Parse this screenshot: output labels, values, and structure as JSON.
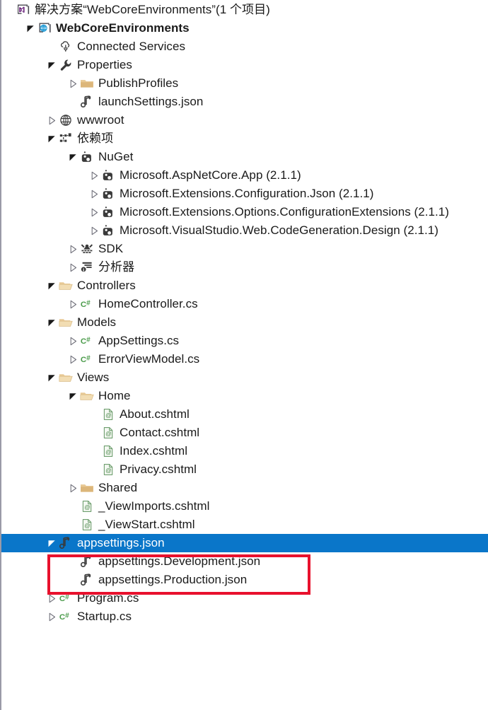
{
  "window": {
    "title": "解决方案“WebCoreEnvironments”(1 个项目)",
    "background_color": "#ffffff",
    "selection_color": "#0a76c9",
    "annotation_color": "#e8112d",
    "text_color": "#1a1a1a"
  },
  "annotation": {
    "name": "red-highlight-box",
    "target_rows": [
      "appsettings.Development.json",
      "appsettings.Production.json"
    ]
  },
  "tree": {
    "nodes": [
      {
        "label": "解决方案“WebCoreEnvironments”(1 个项目)",
        "icon": "visual-studio-solution-icon",
        "depth": 0,
        "expander": "none",
        "bold": false,
        "selected": false
      },
      {
        "label": "WebCoreEnvironments",
        "icon": "web-project-icon",
        "depth": 1,
        "expander": "expanded",
        "bold": true,
        "selected": false
      },
      {
        "label": "Connected Services",
        "icon": "connected-services-icon",
        "depth": 2,
        "expander": "none",
        "bold": false,
        "selected": false
      },
      {
        "label": "Properties",
        "icon": "wrench-icon",
        "depth": 2,
        "expander": "expanded",
        "bold": false,
        "selected": false
      },
      {
        "label": "PublishProfiles",
        "icon": "folder-closed-icon",
        "depth": 3,
        "expander": "collapsed",
        "bold": false,
        "selected": false
      },
      {
        "label": "launchSettings.json",
        "icon": "json-file-icon",
        "depth": 3,
        "expander": "none",
        "bold": false,
        "selected": false
      },
      {
        "label": "wwwroot",
        "icon": "globe-icon",
        "depth": 2,
        "expander": "collapsed",
        "bold": false,
        "selected": false
      },
      {
        "label": "依赖项",
        "icon": "dependencies-icon",
        "depth": 2,
        "expander": "expanded",
        "bold": false,
        "selected": false
      },
      {
        "label": "NuGet",
        "icon": "nuget-package-icon",
        "depth": 3,
        "expander": "expanded",
        "bold": false,
        "selected": false
      },
      {
        "label": "Microsoft.AspNetCore.App (2.1.1)",
        "icon": "nuget-package-icon",
        "depth": 4,
        "expander": "collapsed",
        "bold": false,
        "selected": false
      },
      {
        "label": "Microsoft.Extensions.Configuration.Json (2.1.1)",
        "icon": "nuget-package-icon",
        "depth": 4,
        "expander": "collapsed",
        "bold": false,
        "selected": false
      },
      {
        "label": "Microsoft.Extensions.Options.ConfigurationExtensions (2.1.1)",
        "icon": "nuget-package-icon",
        "depth": 4,
        "expander": "collapsed",
        "bold": false,
        "selected": false
      },
      {
        "label": "Microsoft.VisualStudio.Web.CodeGeneration.Design (2.1.1)",
        "icon": "nuget-package-icon",
        "depth": 4,
        "expander": "collapsed",
        "bold": false,
        "selected": false
      },
      {
        "label": "SDK",
        "icon": "sdk-icon",
        "depth": 3,
        "expander": "collapsed",
        "bold": false,
        "selected": false
      },
      {
        "label": "分析器",
        "icon": "analyzer-icon",
        "depth": 3,
        "expander": "collapsed",
        "bold": false,
        "selected": false
      },
      {
        "label": "Controllers",
        "icon": "folder-open-icon",
        "depth": 2,
        "expander": "expanded",
        "bold": false,
        "selected": false
      },
      {
        "label": "HomeController.cs",
        "icon": "csharp-file-icon",
        "depth": 3,
        "expander": "collapsed",
        "bold": false,
        "selected": false
      },
      {
        "label": "Models",
        "icon": "folder-open-icon",
        "depth": 2,
        "expander": "expanded",
        "bold": false,
        "selected": false
      },
      {
        "label": "AppSettings.cs",
        "icon": "csharp-file-icon",
        "depth": 3,
        "expander": "collapsed",
        "bold": false,
        "selected": false
      },
      {
        "label": "ErrorViewModel.cs",
        "icon": "csharp-file-icon",
        "depth": 3,
        "expander": "collapsed",
        "bold": false,
        "selected": false
      },
      {
        "label": "Views",
        "icon": "folder-open-icon",
        "depth": 2,
        "expander": "expanded",
        "bold": false,
        "selected": false
      },
      {
        "label": "Home",
        "icon": "folder-open-icon",
        "depth": 3,
        "expander": "expanded",
        "bold": false,
        "selected": false
      },
      {
        "label": "About.cshtml",
        "icon": "cshtml-file-icon",
        "depth": 4,
        "expander": "none",
        "bold": false,
        "selected": false
      },
      {
        "label": "Contact.cshtml",
        "icon": "cshtml-file-icon",
        "depth": 4,
        "expander": "none",
        "bold": false,
        "selected": false
      },
      {
        "label": "Index.cshtml",
        "icon": "cshtml-file-icon",
        "depth": 4,
        "expander": "none",
        "bold": false,
        "selected": false
      },
      {
        "label": "Privacy.cshtml",
        "icon": "cshtml-file-icon",
        "depth": 4,
        "expander": "none",
        "bold": false,
        "selected": false
      },
      {
        "label": "Shared",
        "icon": "folder-closed-icon",
        "depth": 3,
        "expander": "collapsed",
        "bold": false,
        "selected": false
      },
      {
        "label": "_ViewImports.cshtml",
        "icon": "cshtml-file-icon",
        "depth": 3,
        "expander": "none",
        "bold": false,
        "selected": false
      },
      {
        "label": "_ViewStart.cshtml",
        "icon": "cshtml-file-icon",
        "depth": 3,
        "expander": "none",
        "bold": false,
        "selected": false
      },
      {
        "label": "appsettings.json",
        "icon": "json-file-icon",
        "depth": 2,
        "expander": "expanded",
        "bold": false,
        "selected": true
      },
      {
        "label": "appsettings.Development.json",
        "icon": "json-file-icon",
        "depth": 3,
        "expander": "none",
        "bold": false,
        "selected": false
      },
      {
        "label": "appsettings.Production.json",
        "icon": "json-file-icon",
        "depth": 3,
        "expander": "none",
        "bold": false,
        "selected": false
      },
      {
        "label": "Program.cs",
        "icon": "csharp-file-icon",
        "depth": 2,
        "expander": "collapsed",
        "bold": false,
        "selected": false
      },
      {
        "label": "Startup.cs",
        "icon": "csharp-file-icon",
        "depth": 2,
        "expander": "collapsed",
        "bold": false,
        "selected": false
      }
    ]
  }
}
